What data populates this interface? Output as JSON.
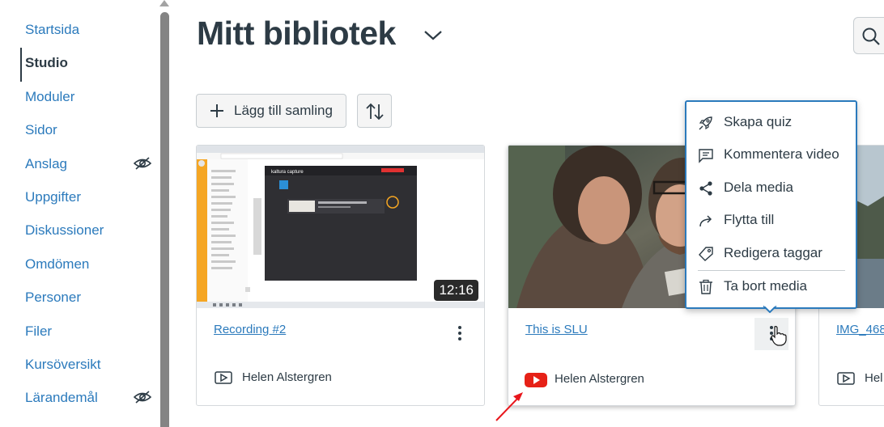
{
  "nav": {
    "items": [
      {
        "label": "Startsida",
        "active": false,
        "hidden_icon": false
      },
      {
        "label": "Studio",
        "active": true,
        "hidden_icon": false
      },
      {
        "label": "Moduler",
        "active": false,
        "hidden_icon": false
      },
      {
        "label": "Sidor",
        "active": false,
        "hidden_icon": false
      },
      {
        "label": "Anslag",
        "active": false,
        "hidden_icon": true
      },
      {
        "label": "Uppgifter",
        "active": false,
        "hidden_icon": false
      },
      {
        "label": "Diskussioner",
        "active": false,
        "hidden_icon": false
      },
      {
        "label": "Omdömen",
        "active": false,
        "hidden_icon": false
      },
      {
        "label": "Personer",
        "active": false,
        "hidden_icon": false
      },
      {
        "label": "Filer",
        "active": false,
        "hidden_icon": false
      },
      {
        "label": "Kursöversikt",
        "active": false,
        "hidden_icon": false
      },
      {
        "label": "Lärandemål",
        "active": false,
        "hidden_icon": true
      }
    ]
  },
  "header": {
    "title": "Mitt bibliotek"
  },
  "toolbar": {
    "add_collection_label": "Lägg till samling"
  },
  "cards": [
    {
      "title": "Recording #2",
      "duration": "12:16",
      "owner": "Helen Alstergren",
      "source_icon": "video-icon"
    },
    {
      "title": "This is SLU",
      "duration": "",
      "owner": "Helen Alstergren",
      "source_icon": "youtube-icon"
    },
    {
      "title": "IMG_468",
      "duration": "",
      "owner": "Hel",
      "source_icon": "video-icon"
    }
  ],
  "menu": {
    "items": [
      {
        "label": "Skapa quiz",
        "icon": "rocket-icon"
      },
      {
        "label": "Kommentera video",
        "icon": "comment-icon"
      },
      {
        "label": "Dela media",
        "icon": "share-icon"
      },
      {
        "label": "Flytta till",
        "icon": "move-arrow-icon"
      },
      {
        "label": "Redigera taggar",
        "icon": "tag-icon"
      },
      {
        "label": "Ta bort media",
        "icon": "trash-icon"
      }
    ]
  },
  "screenshot_text": {
    "kaltura_brand": "kaltura capture"
  },
  "colors": {
    "link": "#2b7abc",
    "text": "#2d3b45",
    "youtube_red": "#e62117",
    "annotation_arrow": "#e8151b"
  }
}
